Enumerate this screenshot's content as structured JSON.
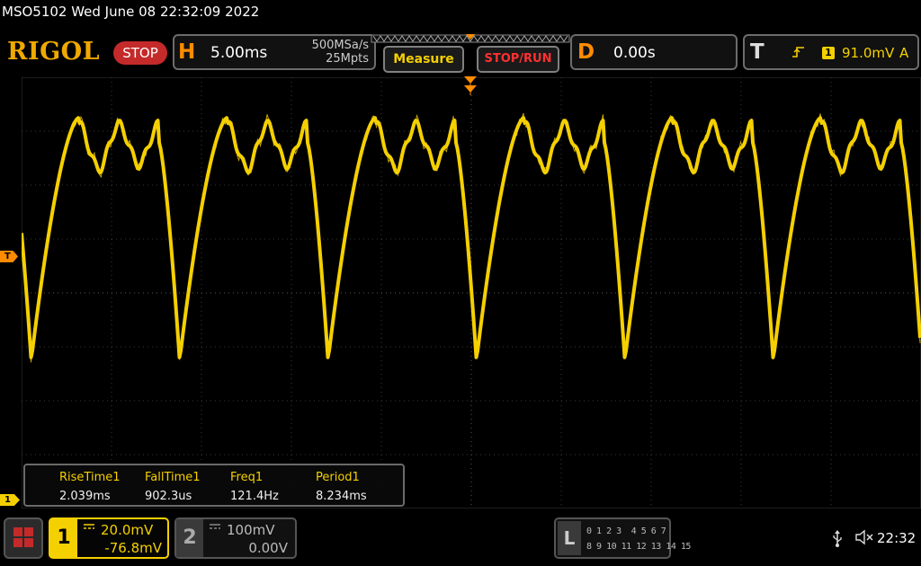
{
  "title_line": "MSO5102  Wed June 08 22:32:09 2022",
  "brand": {
    "logo": "RIGOL",
    "status": "STOP"
  },
  "horizontal": {
    "key": "H",
    "time_base": "5.00ms",
    "sample_rate": "500MSa/s",
    "memory_depth": "25Mpts"
  },
  "buttons": {
    "measure": "Measure",
    "stop_run": "STOP/RUN"
  },
  "delay": {
    "key": "D",
    "value": "0.00s"
  },
  "trigger": {
    "key": "T",
    "edge_icon": "rising-edge-icon",
    "source": "1",
    "level": "91.0mV",
    "mode": "A"
  },
  "markers": {
    "trigger_level": "T",
    "ch1_ground": "1"
  },
  "measurements": [
    {
      "label": "RiseTime1",
      "value": "2.039ms"
    },
    {
      "label": "FallTime1",
      "value": "902.3us"
    },
    {
      "label": "Freq1",
      "value": "121.4Hz"
    },
    {
      "label": "Period1",
      "value": "8.234ms"
    }
  ],
  "channels": {
    "ch1": {
      "number": "1",
      "scale": "20.0mV",
      "offset": "-76.8mV",
      "coupling_icon": "dc-coupling-icon",
      "color": "#f5d000"
    },
    "ch2": {
      "number": "2",
      "scale": "100mV",
      "offset": "0.00V",
      "coupling_icon": "dc-coupling-icon"
    }
  },
  "logic": {
    "key": "L",
    "row1": "0 1 2 3  4 5 6 7",
    "row2": "8 9 10 11 12 13 14 15"
  },
  "status_bar": {
    "usb_icon": "usb-icon",
    "sound_icon": "mute-icon",
    "clock": "22:32"
  },
  "colors": {
    "trace": "#f5d000",
    "accent": "#ff8c00",
    "stop": "#c42a2a",
    "grid": "#3a3a3a"
  }
}
